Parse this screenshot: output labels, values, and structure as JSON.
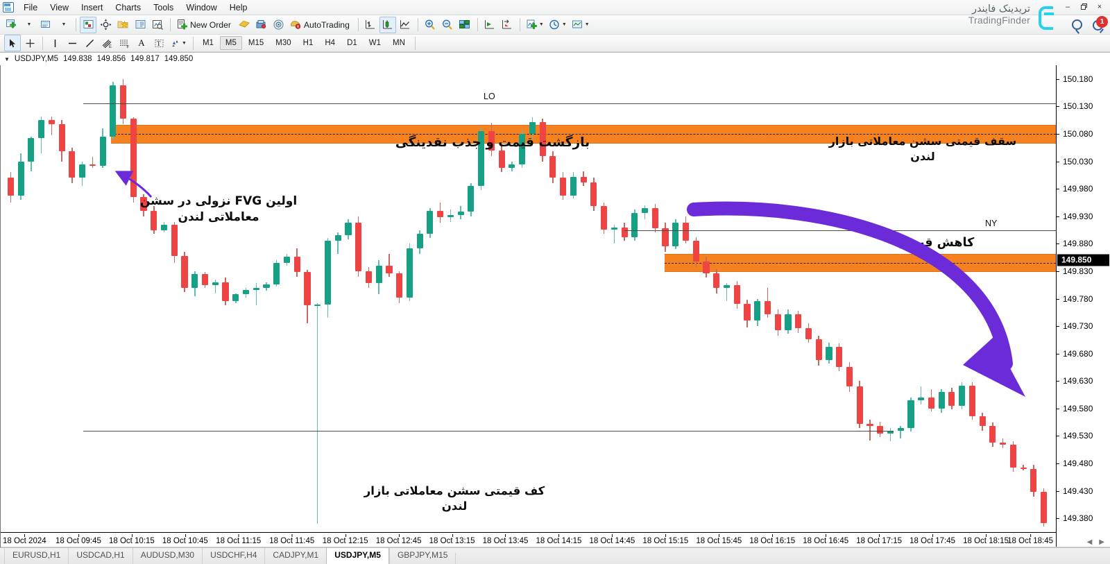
{
  "window": {
    "title": "USDJPY,M5",
    "minimize": "–",
    "maximize": "❐",
    "close": "×"
  },
  "brand": {
    "fa": "تریدینک فایندر",
    "en": "TradingFinder"
  },
  "menubar": {
    "items": [
      {
        "label": "File"
      },
      {
        "label": "View"
      },
      {
        "label": "Insert"
      },
      {
        "label": "Charts"
      },
      {
        "label": "Tools"
      },
      {
        "label": "Window"
      },
      {
        "label": "Help"
      }
    ]
  },
  "toolbar": {
    "new_order_label": "New Order",
    "autotrading_label": "AutoTrading",
    "notification_count": "1",
    "buttons": [
      {
        "name": "new-chart-button",
        "icon": "new-chart-icon"
      },
      {
        "name": "profiles-button",
        "icon": "profiles-icon"
      },
      {
        "name": "market-watch-button",
        "icon": "market-watch-icon"
      },
      {
        "name": "navigator-button",
        "icon": "navigator-icon"
      },
      {
        "name": "favorites-button",
        "icon": "star-folder-icon"
      },
      {
        "name": "terminal-button",
        "icon": "terminal-icon"
      },
      {
        "name": "strategy-tester-button",
        "icon": "tester-icon"
      },
      {
        "name": "new-order-button",
        "icon": "new-order-icon"
      },
      {
        "name": "metaeditor-button",
        "icon": "metaeditor-icon"
      },
      {
        "name": "expert-advisors-button",
        "icon": "expert-advisors-icon"
      },
      {
        "name": "autotrading-button",
        "icon": "autotrading-icon"
      },
      {
        "name": "bar-chart-button",
        "icon": "bar-chart-icon"
      },
      {
        "name": "candlestick-chart-button",
        "icon": "candlestick-icon"
      },
      {
        "name": "line-chart-button",
        "icon": "line-chart-icon"
      },
      {
        "name": "zoom-in-button",
        "icon": "zoom-in-icon"
      },
      {
        "name": "zoom-out-button",
        "icon": "zoom-out-icon"
      },
      {
        "name": "tile-windows-button",
        "icon": "tile-windows-icon"
      },
      {
        "name": "auto-scroll-button",
        "icon": "auto-scroll-icon"
      },
      {
        "name": "chart-shift-button",
        "icon": "chart-shift-icon"
      },
      {
        "name": "indicators-button",
        "icon": "indicators-icon"
      },
      {
        "name": "periods-button",
        "icon": "clock-icon"
      },
      {
        "name": "templates-button",
        "icon": "templates-icon"
      }
    ]
  },
  "linetoolbar": {
    "buttons": [
      {
        "name": "cursor-tool",
        "icon": "cursor-icon"
      },
      {
        "name": "crosshair-tool",
        "icon": "crosshair-icon"
      },
      {
        "name": "vertical-line-tool",
        "icon": "vertical-line-icon"
      },
      {
        "name": "horizontal-line-tool",
        "icon": "horizontal-line-icon"
      },
      {
        "name": "trendline-tool",
        "icon": "trendline-icon"
      },
      {
        "name": "equidistant-channel-tool",
        "icon": "channel-icon"
      },
      {
        "name": "fibonacci-tool",
        "icon": "fibonacci-icon"
      },
      {
        "name": "text-tool",
        "icon": "text-icon"
      },
      {
        "name": "label-tool",
        "icon": "label-icon"
      },
      {
        "name": "shapes-tool",
        "icon": "shapes-icon"
      }
    ],
    "timeframes": [
      {
        "label": "M1",
        "active": false
      },
      {
        "label": "M5",
        "active": true
      },
      {
        "label": "M15",
        "active": false
      },
      {
        "label": "M30",
        "active": false
      },
      {
        "label": "H1",
        "active": false
      },
      {
        "label": "H4",
        "active": false
      },
      {
        "label": "D1",
        "active": false
      },
      {
        "label": "W1",
        "active": false
      },
      {
        "label": "MN",
        "active": false
      }
    ]
  },
  "quote": {
    "symbol": "USDJPY,M5",
    "open": "149.838",
    "high": "149.856",
    "low": "149.817",
    "close": "149.850"
  },
  "chart_data": {
    "type": "candlestick",
    "title": "USDJPY, M5",
    "symbol": "USDJPY",
    "timeframe": "M5",
    "xlabel": "",
    "ylabel": "",
    "ylim": [
      149.355,
      150.205
    ],
    "current_price": "149.850",
    "grid": false,
    "price_ticks": [
      "150.180",
      "150.130",
      "150.080",
      "150.030",
      "149.980",
      "149.930",
      "149.880",
      "149.830",
      "149.780",
      "149.730",
      "149.680",
      "149.630",
      "149.580",
      "149.530",
      "149.480",
      "149.430",
      "149.380"
    ],
    "time_ticks": [
      "18 Oct 2024",
      "18 Oct 09:45",
      "18 Oct 10:15",
      "18 Oct 10:45",
      "18 Oct 11:15",
      "18 Oct 11:45",
      "18 Oct 12:15",
      "18 Oct 12:45",
      "18 Oct 13:15",
      "18 Oct 13:45",
      "18 Oct 14:15",
      "18 Oct 14:45",
      "18 Oct 15:15",
      "18 Oct 15:45",
      "18 Oct 16:15",
      "18 Oct 16:45",
      "18 Oct 17:15",
      "18 Oct 17:45",
      "18 Oct 18:15",
      "18 Oct 18:45"
    ],
    "colors": {
      "bull": "#16a085",
      "bear": "#ef4444",
      "fvg_zone": "#F58220",
      "arrow": "#6c2bd9",
      "structure_line": "#4a4a4a"
    },
    "candles": [
      {
        "o": 150.0,
        "h": 150.01,
        "l": 149.955,
        "c": 149.968
      },
      {
        "o": 149.968,
        "h": 150.045,
        "l": 149.96,
        "c": 150.03
      },
      {
        "o": 150.03,
        "h": 150.075,
        "l": 150.012,
        "c": 150.072
      },
      {
        "o": 150.072,
        "h": 150.112,
        "l": 150.045,
        "c": 150.105
      },
      {
        "o": 150.105,
        "h": 150.112,
        "l": 150.078,
        "c": 150.098
      },
      {
        "o": 150.098,
        "h": 150.105,
        "l": 150.03,
        "c": 150.048
      },
      {
        "o": 150.048,
        "h": 150.055,
        "l": 149.99,
        "c": 150.0
      },
      {
        "o": 150.0,
        "h": 150.03,
        "l": 149.985,
        "c": 150.025
      },
      {
        "o": 150.025,
        "h": 150.038,
        "l": 150.018,
        "c": 150.022
      },
      {
        "o": 150.022,
        "h": 150.09,
        "l": 150.018,
        "c": 150.075
      },
      {
        "o": 150.075,
        "h": 150.175,
        "l": 150.07,
        "c": 150.168
      },
      {
        "o": 150.168,
        "h": 150.18,
        "l": 150.098,
        "c": 150.108
      },
      {
        "o": 150.108,
        "h": 150.11,
        "l": 149.955,
        "c": 149.965
      },
      {
        "o": 149.965,
        "h": 149.97,
        "l": 149.93,
        "c": 149.94
      },
      {
        "o": 149.94,
        "h": 149.948,
        "l": 149.898,
        "c": 149.905
      },
      {
        "o": 149.905,
        "h": 149.92,
        "l": 149.9,
        "c": 149.915
      },
      {
        "o": 149.915,
        "h": 149.92,
        "l": 149.845,
        "c": 149.858
      },
      {
        "o": 149.858,
        "h": 149.865,
        "l": 149.792,
        "c": 149.8
      },
      {
        "o": 149.8,
        "h": 149.83,
        "l": 149.785,
        "c": 149.825
      },
      {
        "o": 149.825,
        "h": 149.828,
        "l": 149.8,
        "c": 149.805
      },
      {
        "o": 149.805,
        "h": 149.815,
        "l": 149.79,
        "c": 149.81
      },
      {
        "o": 149.81,
        "h": 149.818,
        "l": 149.768,
        "c": 149.775
      },
      {
        "o": 149.775,
        "h": 149.79,
        "l": 149.772,
        "c": 149.788
      },
      {
        "o": 149.788,
        "h": 149.8,
        "l": 149.782,
        "c": 149.796
      },
      {
        "o": 149.796,
        "h": 149.808,
        "l": 149.768,
        "c": 149.8
      },
      {
        "o": 149.8,
        "h": 149.81,
        "l": 149.795,
        "c": 149.806
      },
      {
        "o": 149.806,
        "h": 149.85,
        "l": 149.802,
        "c": 149.845
      },
      {
        "o": 149.845,
        "h": 149.862,
        "l": 149.84,
        "c": 149.856
      },
      {
        "o": 149.856,
        "h": 149.872,
        "l": 149.82,
        "c": 149.828
      },
      {
        "o": 149.828,
        "h": 149.832,
        "l": 149.735,
        "c": 149.768
      },
      {
        "o": 149.768,
        "h": 149.772,
        "l": 149.37,
        "c": 149.769
      },
      {
        "o": 149.769,
        "h": 149.89,
        "l": 149.745,
        "c": 149.886
      },
      {
        "o": 149.886,
        "h": 149.9,
        "l": 149.862,
        "c": 149.896
      },
      {
        "o": 149.896,
        "h": 149.925,
        "l": 149.888,
        "c": 149.918
      },
      {
        "o": 149.918,
        "h": 149.93,
        "l": 149.82,
        "c": 149.83
      },
      {
        "o": 149.83,
        "h": 149.838,
        "l": 149.8,
        "c": 149.808
      },
      {
        "o": 149.808,
        "h": 149.85,
        "l": 149.788,
        "c": 149.84
      },
      {
        "o": 149.84,
        "h": 149.862,
        "l": 149.82,
        "c": 149.826
      },
      {
        "o": 149.826,
        "h": 149.83,
        "l": 149.772,
        "c": 149.782
      },
      {
        "o": 149.782,
        "h": 149.88,
        "l": 149.776,
        "c": 149.872
      },
      {
        "o": 149.872,
        "h": 149.905,
        "l": 149.862,
        "c": 149.898
      },
      {
        "o": 149.898,
        "h": 149.945,
        "l": 149.89,
        "c": 149.94
      },
      {
        "o": 149.94,
        "h": 149.955,
        "l": 149.918,
        "c": 149.928
      },
      {
        "o": 149.928,
        "h": 149.942,
        "l": 149.92,
        "c": 149.932
      },
      {
        "o": 149.932,
        "h": 149.948,
        "l": 149.925,
        "c": 149.938
      },
      {
        "o": 149.938,
        "h": 149.99,
        "l": 149.93,
        "c": 149.985
      },
      {
        "o": 149.985,
        "h": 150.09,
        "l": 149.978,
        "c": 150.085
      },
      {
        "o": 150.085,
        "h": 150.1,
        "l": 150.04,
        "c": 150.05
      },
      {
        "o": 150.05,
        "h": 150.058,
        "l": 150.01,
        "c": 150.018
      },
      {
        "o": 150.018,
        "h": 150.03,
        "l": 150.012,
        "c": 150.025
      },
      {
        "o": 150.025,
        "h": 150.088,
        "l": 150.018,
        "c": 150.08
      },
      {
        "o": 150.08,
        "h": 150.11,
        "l": 150.07,
        "c": 150.102
      },
      {
        "o": 150.102,
        "h": 150.108,
        "l": 150.03,
        "c": 150.04
      },
      {
        "o": 150.04,
        "h": 150.048,
        "l": 149.99,
        "c": 150.0
      },
      {
        "o": 150.0,
        "h": 150.01,
        "l": 149.96,
        "c": 149.968
      },
      {
        "o": 149.968,
        "h": 150.01,
        "l": 149.962,
        "c": 150.002
      },
      {
        "o": 150.002,
        "h": 150.012,
        "l": 149.985,
        "c": 149.992
      },
      {
        "o": 149.992,
        "h": 150.0,
        "l": 149.94,
        "c": 149.948
      },
      {
        "o": 149.948,
        "h": 149.955,
        "l": 149.898,
        "c": 149.906
      },
      {
        "o": 149.906,
        "h": 149.915,
        "l": 149.88,
        "c": 149.91
      },
      {
        "o": 149.91,
        "h": 149.918,
        "l": 149.885,
        "c": 149.892
      },
      {
        "o": 149.892,
        "h": 149.942,
        "l": 149.886,
        "c": 149.936
      },
      {
        "o": 149.936,
        "h": 149.95,
        "l": 149.925,
        "c": 149.945
      },
      {
        "o": 149.945,
        "h": 149.952,
        "l": 149.9,
        "c": 149.908
      },
      {
        "o": 149.908,
        "h": 149.918,
        "l": 149.865,
        "c": 149.875
      },
      {
        "o": 149.875,
        "h": 149.925,
        "l": 149.87,
        "c": 149.918
      },
      {
        "o": 149.918,
        "h": 149.93,
        "l": 149.88,
        "c": 149.886
      },
      {
        "o": 149.886,
        "h": 149.892,
        "l": 149.838,
        "c": 149.848
      },
      {
        "o": 149.848,
        "h": 149.856,
        "l": 149.818,
        "c": 149.826
      },
      {
        "o": 149.826,
        "h": 149.834,
        "l": 149.79,
        "c": 149.8
      },
      {
        "o": 149.8,
        "h": 149.808,
        "l": 149.775,
        "c": 149.804
      },
      {
        "o": 149.804,
        "h": 149.812,
        "l": 149.762,
        "c": 149.77
      },
      {
        "o": 149.77,
        "h": 149.778,
        "l": 149.728,
        "c": 149.74
      },
      {
        "o": 149.74,
        "h": 149.78,
        "l": 149.73,
        "c": 149.775
      },
      {
        "o": 149.775,
        "h": 149.8,
        "l": 149.745,
        "c": 149.752
      },
      {
        "o": 149.752,
        "h": 149.76,
        "l": 149.712,
        "c": 149.722
      },
      {
        "o": 149.722,
        "h": 149.76,
        "l": 149.716,
        "c": 149.752
      },
      {
        "o": 149.752,
        "h": 149.758,
        "l": 149.718,
        "c": 149.726
      },
      {
        "o": 149.726,
        "h": 149.735,
        "l": 149.7,
        "c": 149.706
      },
      {
        "o": 149.706,
        "h": 149.712,
        "l": 149.658,
        "c": 149.668
      },
      {
        "o": 149.668,
        "h": 149.7,
        "l": 149.662,
        "c": 149.692
      },
      {
        "o": 149.692,
        "h": 149.698,
        "l": 149.648,
        "c": 149.656
      },
      {
        "o": 149.656,
        "h": 149.665,
        "l": 149.61,
        "c": 149.62
      },
      {
        "o": 149.62,
        "h": 149.63,
        "l": 149.545,
        "c": 149.552
      },
      {
        "o": 149.552,
        "h": 149.56,
        "l": 149.522,
        "c": 149.548
      },
      {
        "o": 149.548,
        "h": 149.556,
        "l": 149.528,
        "c": 149.534
      },
      {
        "o": 149.534,
        "h": 149.545,
        "l": 149.52,
        "c": 149.54
      },
      {
        "o": 149.54,
        "h": 149.548,
        "l": 149.526,
        "c": 149.544
      },
      {
        "o": 149.544,
        "h": 149.6,
        "l": 149.538,
        "c": 149.595
      },
      {
        "o": 149.595,
        "h": 149.62,
        "l": 149.588,
        "c": 149.6
      },
      {
        "o": 149.6,
        "h": 149.615,
        "l": 149.575,
        "c": 149.58
      },
      {
        "o": 149.58,
        "h": 149.615,
        "l": 149.572,
        "c": 149.61
      },
      {
        "o": 149.61,
        "h": 149.618,
        "l": 149.578,
        "c": 149.585
      },
      {
        "o": 149.585,
        "h": 149.628,
        "l": 149.578,
        "c": 149.622
      },
      {
        "o": 149.622,
        "h": 149.628,
        "l": 149.56,
        "c": 149.566
      },
      {
        "o": 149.566,
        "h": 149.572,
        "l": 149.54,
        "c": 149.548
      },
      {
        "o": 149.548,
        "h": 149.555,
        "l": 149.51,
        "c": 149.518
      },
      {
        "o": 149.518,
        "h": 149.525,
        "l": 149.508,
        "c": 149.514
      },
      {
        "o": 149.514,
        "h": 149.52,
        "l": 149.465,
        "c": 149.472
      },
      {
        "o": 149.472,
        "h": 149.478,
        "l": 149.468,
        "c": 149.47
      },
      {
        "o": 149.47,
        "h": 149.478,
        "l": 149.42,
        "c": 149.428
      },
      {
        "o": 149.428,
        "h": 149.435,
        "l": 149.365,
        "c": 149.372
      }
    ],
    "fvg_zones": [
      {
        "label": "london-session-high-fvg",
        "top": 150.097,
        "bottom": 150.062
      },
      {
        "label": "ny-session-fvg",
        "top": 149.862,
        "bottom": 149.828
      }
    ],
    "structure_lines": [
      {
        "label": "LO",
        "price": 150.135
      },
      {
        "label": "NY",
        "price": 149.905
      },
      {
        "label": "london-low",
        "price": 149.54
      }
    ],
    "session_labels": [
      {
        "text": "LO"
      },
      {
        "text": "NY"
      }
    ],
    "annotations": [
      {
        "id": "return-liquidity",
        "text": "بازگشت قیمت و جذب نقدینگی"
      },
      {
        "id": "london-high",
        "line1": "سقف قیمتی سشن معاملاتی بازار",
        "line2": "لندن"
      },
      {
        "id": "first-bearish-fvg",
        "line1": "اولین FVG نزولی در سشن",
        "line2": "معاملاتی لندن"
      },
      {
        "id": "price-decline",
        "text": "کاهش قیمت"
      },
      {
        "id": "london-low",
        "line1": "کف قیمتی سشن معاملاتی بازار",
        "line2": "لندن"
      }
    ]
  },
  "tabbar": {
    "tabs": [
      {
        "label": "EURUSD,H1",
        "active": false
      },
      {
        "label": "USDCAD,H1",
        "active": false
      },
      {
        "label": "AUDUSD,M30",
        "active": false
      },
      {
        "label": "USDCHF,H4",
        "active": false
      },
      {
        "label": "CADJPY,M1",
        "active": false
      },
      {
        "label": "USDJPY,M5",
        "active": true
      },
      {
        "label": "GBPJPY,M15",
        "active": false
      }
    ],
    "scroll_left": "◀",
    "scroll_right": "▶"
  }
}
